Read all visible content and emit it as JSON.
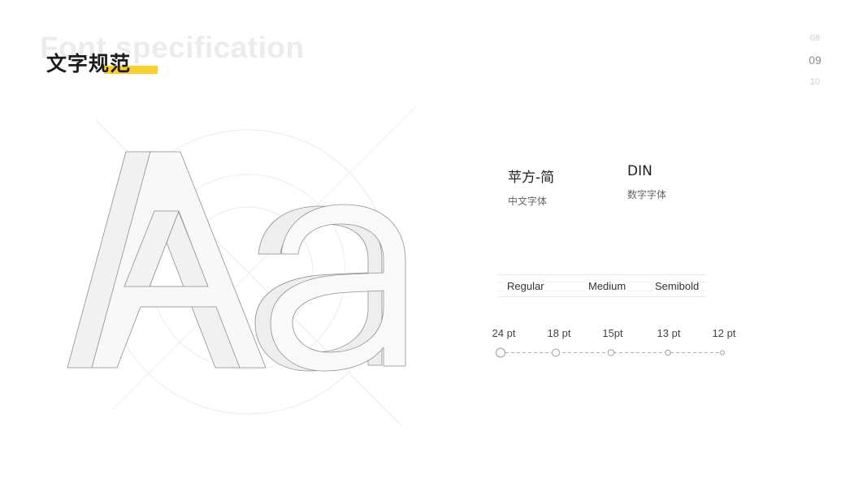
{
  "header": {
    "bg_title": "Font specification",
    "title": "文字规范",
    "accent_color": "#f9cf2a"
  },
  "pager": {
    "prev": "08",
    "current": "09",
    "next": "10"
  },
  "showcase": {
    "glyphs": "Aa",
    "fonts": [
      {
        "name": "苹方-简",
        "desc": "中文字体"
      },
      {
        "name": "DIN",
        "desc": "数字字体"
      }
    ],
    "weights": [
      "Regular",
      "Medium",
      "Semibold"
    ],
    "sizes": [
      "24 pt",
      "18 pt",
      "15pt",
      "13 pt",
      "12 pt"
    ]
  }
}
